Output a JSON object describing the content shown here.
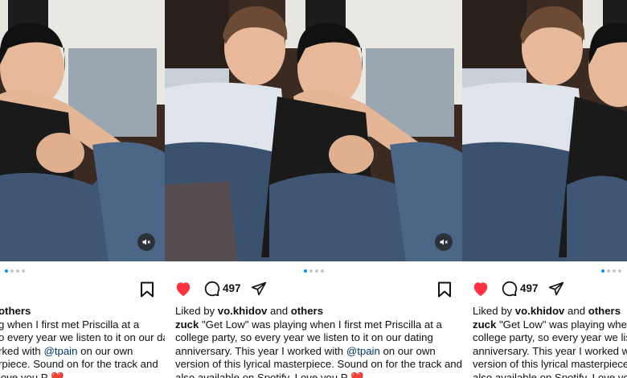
{
  "post": {
    "likes_count": "497",
    "liked_by_prefix": "Liked by",
    "liked_by_user": "vo.khidov",
    "liked_by_and": "and",
    "liked_by_others": "others",
    "author": "zuck",
    "caption_lines": [
      "\"Get Low\" was playing when I first met Priscilla at a",
      "college party, so every year we listen to it on our dating",
      "anniversary. This year I worked with",
      "version of this lyrical masterpiece. Sound on for the track and",
      "also available on Spotify. Love you P"
    ],
    "mention": "@tpain",
    "line3_after_mention": "on our own",
    "heart_emoji": "❤️"
  },
  "left_panel": {
    "caption_lines": [
      "g when I first met Priscilla at a",
      "o every year we listen to it on our dating",
      "rked with",
      "rpiece. Sound on for the track and",
      "love you P"
    ],
    "line3_after_mention": "on our own",
    "others_fragment": "others"
  },
  "right_panel": {
    "caption_lines": [
      "\"Get Low\" was playing when I first met Priscilla at a",
      "college party, so every year we listen to it on our dating",
      "anniversary. This year I worked with",
      "version of this lyrical masterpiece. Sound on for the track and",
      "also available on Spotify. Love you P"
    ]
  },
  "carousel": {
    "current": 1,
    "total": 4
  },
  "colors": {
    "accent_blue": "#0095f6",
    "like_red": "#ff3040",
    "mention": "#00376b"
  }
}
